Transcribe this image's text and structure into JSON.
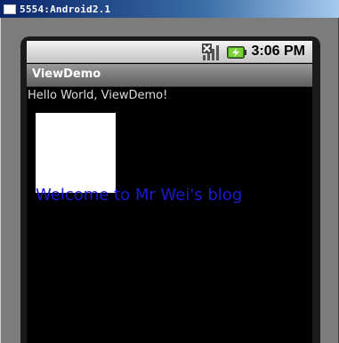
{
  "window": {
    "title": "5554:Android2.1"
  },
  "statusbar": {
    "signal_icon": "no-signal-icon",
    "battery_icon": "battery-charging-icon",
    "time": "3:06 PM"
  },
  "app": {
    "title": "ViewDemo",
    "hello_text": "Hello World, ViewDemo!",
    "welcome_text": "Welcome to Mr Wei's blog",
    "welcome_color": "#1a1ad0",
    "box_color": "#ffffff"
  }
}
